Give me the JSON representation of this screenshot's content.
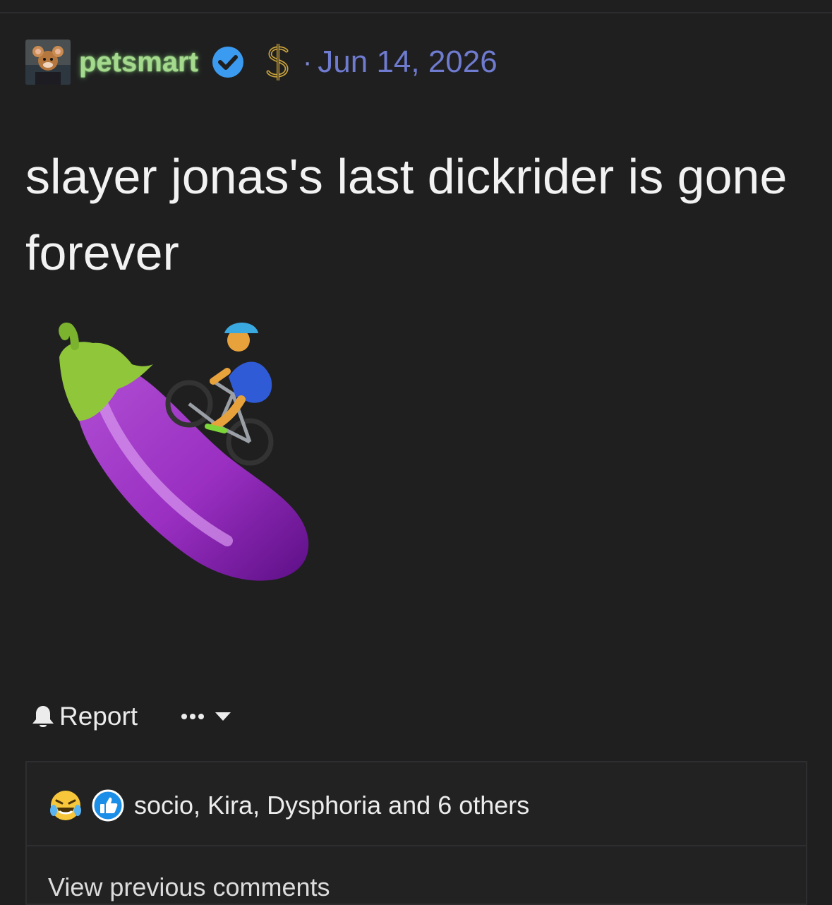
{
  "post": {
    "author": "petsmart",
    "separator": "·",
    "date": "Jun 14, 2026",
    "text": "slayer jonas's last dickrider is gone forever",
    "image_description_icons": [
      "eggplant-icon",
      "cyclist-icon"
    ]
  },
  "actions": {
    "report_label": "Report"
  },
  "reactions": {
    "icons": [
      "laughing-crying-icon",
      "thumbs-up-icon"
    ],
    "summary": "socio, Kira, Dysphoria and 6 others",
    "view_comments": "View previous comments"
  },
  "colors": {
    "background": "#1f1f20",
    "username": "#a5d98d",
    "date": "#6f7bcf",
    "verified": "#3b9bf0",
    "dollar": "#c8a23a"
  }
}
